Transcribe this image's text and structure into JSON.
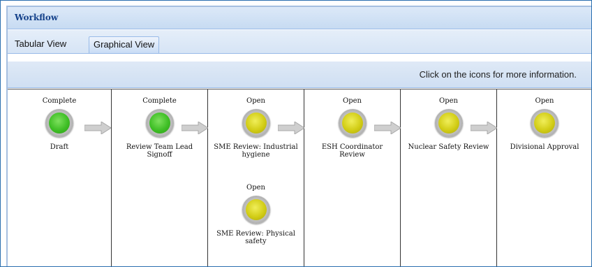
{
  "panel": {
    "title": "Workflow"
  },
  "tabs": [
    {
      "label": "Tabular View",
      "active": false
    },
    {
      "label": "Graphical View",
      "active": true
    }
  ],
  "info": {
    "text": "Click on the icons for more information."
  },
  "colors": {
    "complete": "#3fbf26",
    "open": "#d2cd16",
    "header_text": "#15428b"
  },
  "stages": [
    {
      "steps": [
        {
          "status": "Complete",
          "state": "complete",
          "label": "Draft"
        }
      ]
    },
    {
      "steps": [
        {
          "status": "Complete",
          "state": "complete",
          "label": "Review Team Lead Signoff"
        }
      ]
    },
    {
      "steps": [
        {
          "status": "Open",
          "state": "open",
          "label": "SME Review: Industrial hygiene"
        },
        {
          "status": "Open",
          "state": "open",
          "label": "SME Review: Physical safety"
        }
      ]
    },
    {
      "steps": [
        {
          "status": "Open",
          "state": "open",
          "label": "ESH Coordinator Review"
        }
      ]
    },
    {
      "steps": [
        {
          "status": "Open",
          "state": "open",
          "label": "Nuclear Safety Review"
        }
      ]
    },
    {
      "steps": [
        {
          "status": "Open",
          "state": "open",
          "label": "Divisional Approval"
        }
      ]
    }
  ]
}
